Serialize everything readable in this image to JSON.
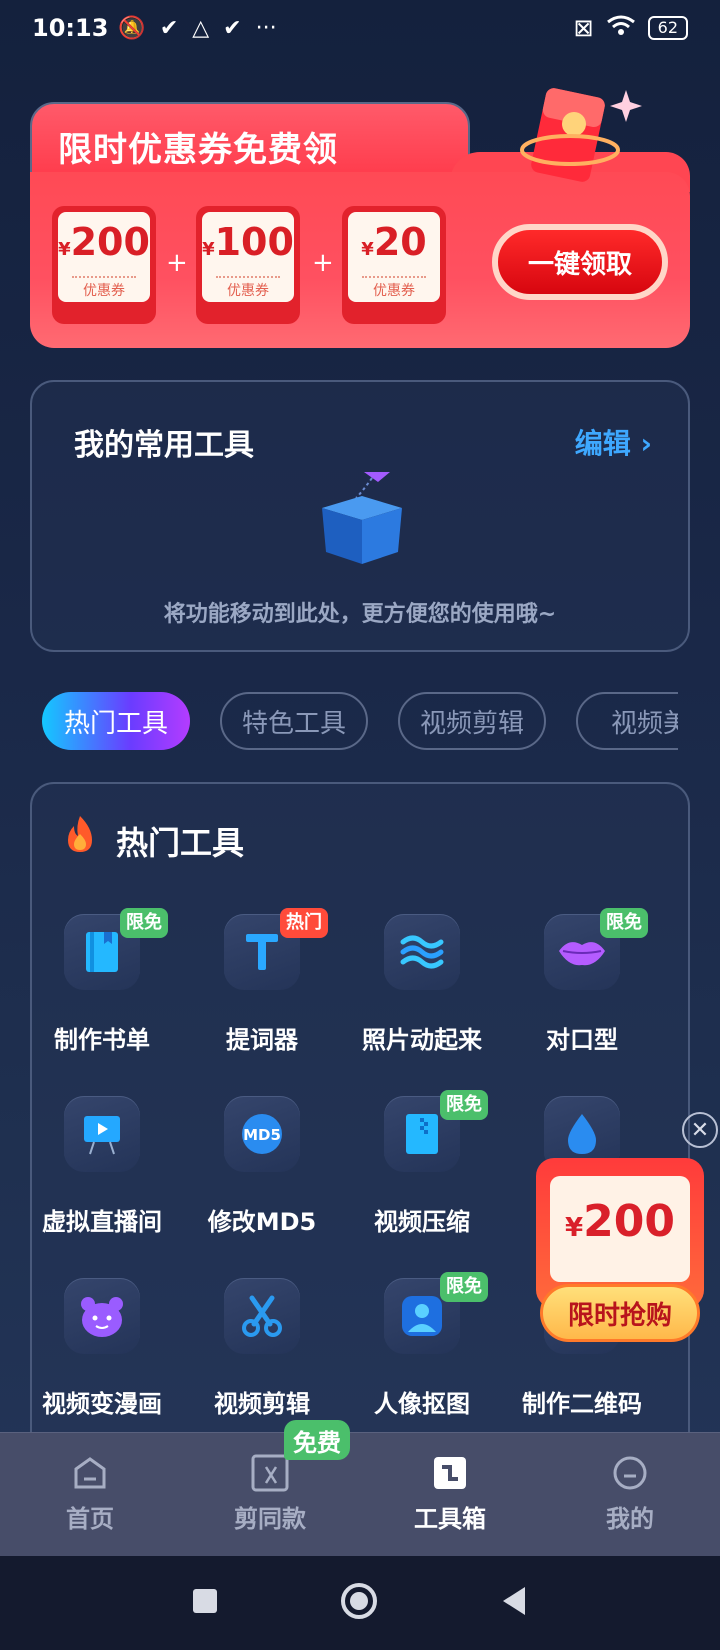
{
  "status_bar": {
    "time": "10:13",
    "battery": "62"
  },
  "promo_banner": {
    "title": "限时优惠券免费领",
    "coupons": [
      {
        "currency": "¥",
        "amount": "200",
        "label": "优惠券"
      },
      {
        "currency": "¥",
        "amount": "100",
        "label": "优惠券"
      },
      {
        "currency": "¥",
        "amount": "20",
        "label": "优惠券"
      }
    ],
    "plus": "+",
    "claim_label": "一键领取"
  },
  "common_tools": {
    "title": "我的常用工具",
    "edit_label": "编辑",
    "empty_hint": "将功能移动到此处，更方便您的使用哦~"
  },
  "category_tabs": [
    {
      "label": "热门工具",
      "active": true
    },
    {
      "label": "特色工具",
      "active": false
    },
    {
      "label": "视频剪辑",
      "active": false
    },
    {
      "label": "视频美",
      "active": false
    }
  ],
  "hot_section": {
    "title": "热门工具",
    "tools": [
      {
        "name": "制作书单",
        "badge": "限免",
        "icon": "book-icon"
      },
      {
        "name": "提词器",
        "badge": "热门",
        "icon": "text-t-icon"
      },
      {
        "name": "照片动起来",
        "badge": "",
        "icon": "waves-icon"
      },
      {
        "name": "对口型",
        "badge": "限免",
        "icon": "lips-icon"
      },
      {
        "name": "虚拟直播间",
        "badge": "",
        "icon": "live-screen-icon"
      },
      {
        "name": "修改MD5",
        "badge": "",
        "icon": "md5-icon"
      },
      {
        "name": "视频压缩",
        "badge": "限免",
        "icon": "compress-icon"
      },
      {
        "name": "",
        "badge": "",
        "icon": "drop-icon"
      },
      {
        "name": "视频变漫画",
        "badge": "",
        "icon": "bear-icon"
      },
      {
        "name": "视频剪辑",
        "badge": "",
        "icon": "scissors-icon"
      },
      {
        "name": "人像抠图",
        "badge": "限免",
        "icon": "portrait-icon"
      },
      {
        "name": "制作二维码",
        "badge": "",
        "icon": "qrcode-icon"
      }
    ],
    "md5_text": "MD5"
  },
  "float_ad": {
    "currency": "¥",
    "amount": "200",
    "button_label": "限时抢购"
  },
  "tab_bar": {
    "items": [
      {
        "label": "首页",
        "icon": "home-icon",
        "active": false
      },
      {
        "label": "剪同款",
        "icon": "template-cut-icon",
        "active": false
      },
      {
        "label": "工具箱",
        "icon": "toolbox-icon",
        "active": true
      },
      {
        "label": "我的",
        "icon": "profile-icon",
        "active": false
      }
    ],
    "free_badge": "免费"
  },
  "colors": {
    "accent": "#3ea8ff",
    "promo_red": "#ff3646",
    "free_green": "#4bbf6b",
    "hot_red": "#ff4b3a"
  }
}
